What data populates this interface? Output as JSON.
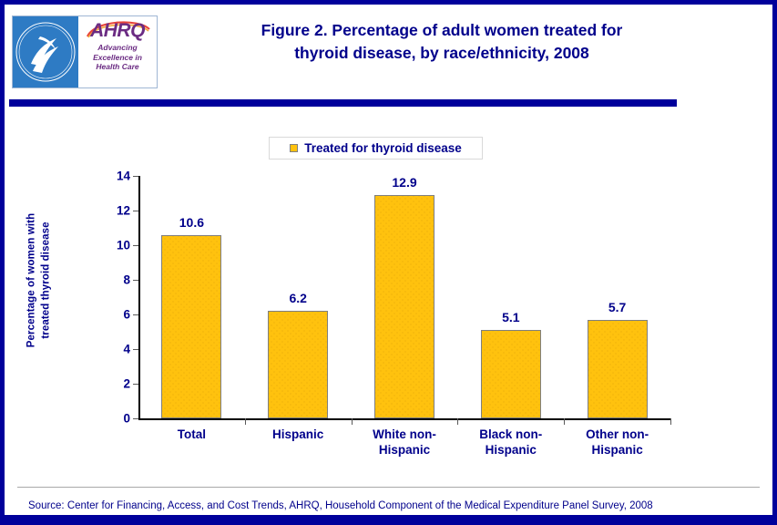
{
  "document": {
    "title_line1": "Figure 2. Percentage of adult women treated for",
    "title_line2": "thyroid disease, by race/ethnicity, 2008",
    "source": "Source: Center for Financing, Access, and Cost Trends, AHRQ, Household Component of the Medical Expenditure Panel Survey,  2008"
  },
  "logo": {
    "hhs_seal_alt": "hhs-seal-icon",
    "ahrq_wordmark": "AHRQ",
    "ahrq_tagline_line1": "Advancing",
    "ahrq_tagline_line2": "Excellence in",
    "ahrq_tagline_line3": "Health Care"
  },
  "colors": {
    "page_border": "#00009B",
    "navy_rule": "#00009B",
    "text_navy": "#00008B",
    "bar_fill": "#FFC20E",
    "bar_border": "#7F7F7F",
    "legend_border": "#D9D9D9"
  },
  "chart_data": {
    "type": "bar",
    "title": "Figure 2. Percentage of adult women treated for thyroid disease, by race/ethnicity, 2008",
    "xlabel": "",
    "ylabel": "Percentage of women with treated thyroid disease",
    "ylabel_line1": "Percentage of women with",
    "ylabel_line2": "treated thyroid disease",
    "categories": [
      "Total",
      "Hispanic",
      "White non-Hispanic",
      "Black non-Hispanic",
      "Other non-Hispanic"
    ],
    "category_lines": [
      [
        "Total"
      ],
      [
        "Hispanic"
      ],
      [
        "White non-",
        "Hispanic"
      ],
      [
        "Black non-",
        "Hispanic"
      ],
      [
        "Other non-",
        "Hispanic"
      ]
    ],
    "values": [
      10.6,
      6.2,
      12.9,
      5.1,
      5.7
    ],
    "value_labels": [
      "10.6",
      "6.2",
      "12.9",
      "5.1",
      "5.7"
    ],
    "ylim": [
      0,
      14
    ],
    "yticks": [
      0,
      2,
      4,
      6,
      8,
      10,
      12,
      14
    ],
    "ytick_labels": [
      "0",
      "2",
      "4",
      "6",
      "8",
      "10",
      "12",
      "14"
    ],
    "grid": false,
    "legend": {
      "position": "top-center",
      "entries": [
        {
          "label": "Treated for thyroid disease",
          "color": "#FFC20E"
        }
      ]
    }
  }
}
